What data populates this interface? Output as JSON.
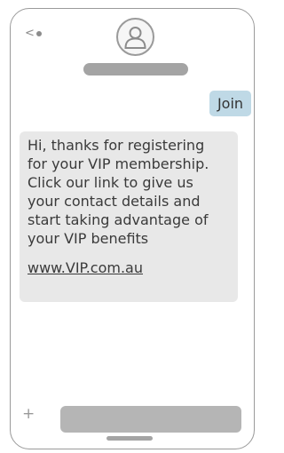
{
  "header": {
    "back_label": "<",
    "back_icon": "back-arrow-icon",
    "avatar_icon": "user-avatar-icon"
  },
  "thread": {
    "sent_message": "Join",
    "received_message": "Hi, thanks for registering\nfor your VIP membership.\nClick our link to give us\nyour contact details and\nstart  taking advantage of\nyour VIP benefits",
    "link_text": "www.VIP.com.au"
  },
  "composer": {
    "add_label": "+",
    "add_icon": "plus-icon"
  },
  "colors": {
    "sent_bubble": "#bfd9e6",
    "received_bubble": "#e8e8e8",
    "placeholder_gray": "#a4a4a4",
    "frame_border": "#9a9a9a"
  }
}
